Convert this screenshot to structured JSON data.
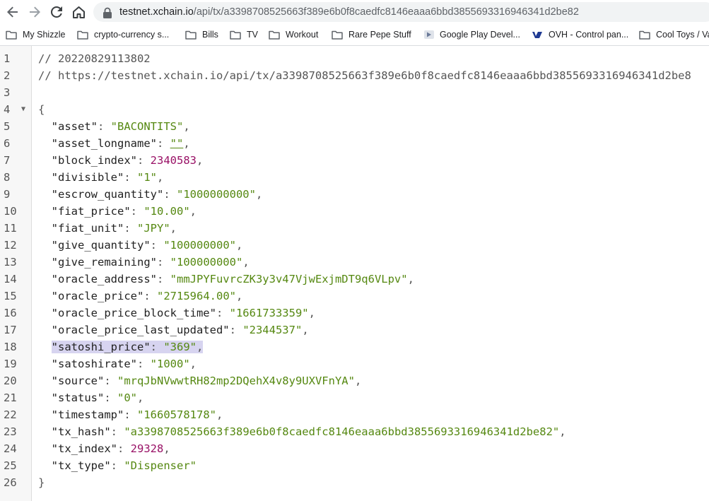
{
  "browser": {
    "url_host": "testnet.xchain.io",
    "url_path": "/api/tx/a3398708525663f389e6b0f8caedfc8146eaaa6bbd3855693316946341d2be82",
    "bookmarks": [
      {
        "label": "My Shizzle",
        "icon": "folder-icon"
      },
      {
        "label": "crypto-currency s...",
        "icon": "folder-icon"
      },
      {
        "label": "Bills",
        "icon": "folder-icon"
      },
      {
        "label": "TV",
        "icon": "folder-icon"
      },
      {
        "label": "Workout",
        "icon": "folder-icon"
      },
      {
        "label": "Rare Pepe Stuff",
        "icon": "folder-icon"
      },
      {
        "label": "Google Play Devel...",
        "icon": "google-play-icon"
      },
      {
        "label": "OVH - Control pan...",
        "icon": "ovh-icon"
      },
      {
        "label": "Cool Toys / Va",
        "icon": "folder-icon"
      }
    ]
  },
  "document": {
    "comment_date": "// 20220829113802",
    "comment_url": "// https://testnet.xchain.io/api/tx/a3398708525663f389e6b0f8caedfc8146eaaa6bbd3855693316946341d2be8",
    "open_brace": "{",
    "close_brace": "}",
    "entries": [
      {
        "key": "\"asset\"",
        "value": "\"BACONTITS\"",
        "type": "str"
      },
      {
        "key": "\"asset_longname\"",
        "value": "\"\"",
        "type": "empty"
      },
      {
        "key": "\"block_index\"",
        "value": "2340583",
        "type": "num"
      },
      {
        "key": "\"divisible\"",
        "value": "\"1\"",
        "type": "str"
      },
      {
        "key": "\"escrow_quantity\"",
        "value": "\"1000000000\"",
        "type": "str"
      },
      {
        "key": "\"fiat_price\"",
        "value": "\"10.00\"",
        "type": "str"
      },
      {
        "key": "\"fiat_unit\"",
        "value": "\"JPY\"",
        "type": "str"
      },
      {
        "key": "\"give_quantity\"",
        "value": "\"100000000\"",
        "type": "str"
      },
      {
        "key": "\"give_remaining\"",
        "value": "\"100000000\"",
        "type": "str"
      },
      {
        "key": "\"oracle_address\"",
        "value": "\"mmJPYFuvrcZK3y3v47VjwExjmDT9q6VLpv\"",
        "type": "str"
      },
      {
        "key": "\"oracle_price\"",
        "value": "\"2715964.00\"",
        "type": "str"
      },
      {
        "key": "\"oracle_price_block_time\"",
        "value": "\"1661733359\"",
        "type": "str"
      },
      {
        "key": "\"oracle_price_last_updated\"",
        "value": "\"2344537\"",
        "type": "str"
      },
      {
        "key": "\"satoshi_price\"",
        "value": "\"369\"",
        "type": "str",
        "highlight": true
      },
      {
        "key": "\"satoshirate\"",
        "value": "\"1000\"",
        "type": "str"
      },
      {
        "key": "\"source\"",
        "value": "\"mrqJbNVwwtRH82mp2DQehX4v8y9UXVFnYA\"",
        "type": "str"
      },
      {
        "key": "\"status\"",
        "value": "\"0\"",
        "type": "str"
      },
      {
        "key": "\"timestamp\"",
        "value": "\"1660578178\"",
        "type": "str"
      },
      {
        "key": "\"tx_hash\"",
        "value": "\"a3398708525663f389e6b0f8caedfc8146eaaa6bbd3855693316946341d2be82\"",
        "type": "str"
      },
      {
        "key": "\"tx_index\"",
        "value": "29328",
        "type": "num"
      },
      {
        "key": "\"tx_type\"",
        "value": "\"Dispenser\"",
        "type": "str",
        "last": true
      }
    ]
  }
}
